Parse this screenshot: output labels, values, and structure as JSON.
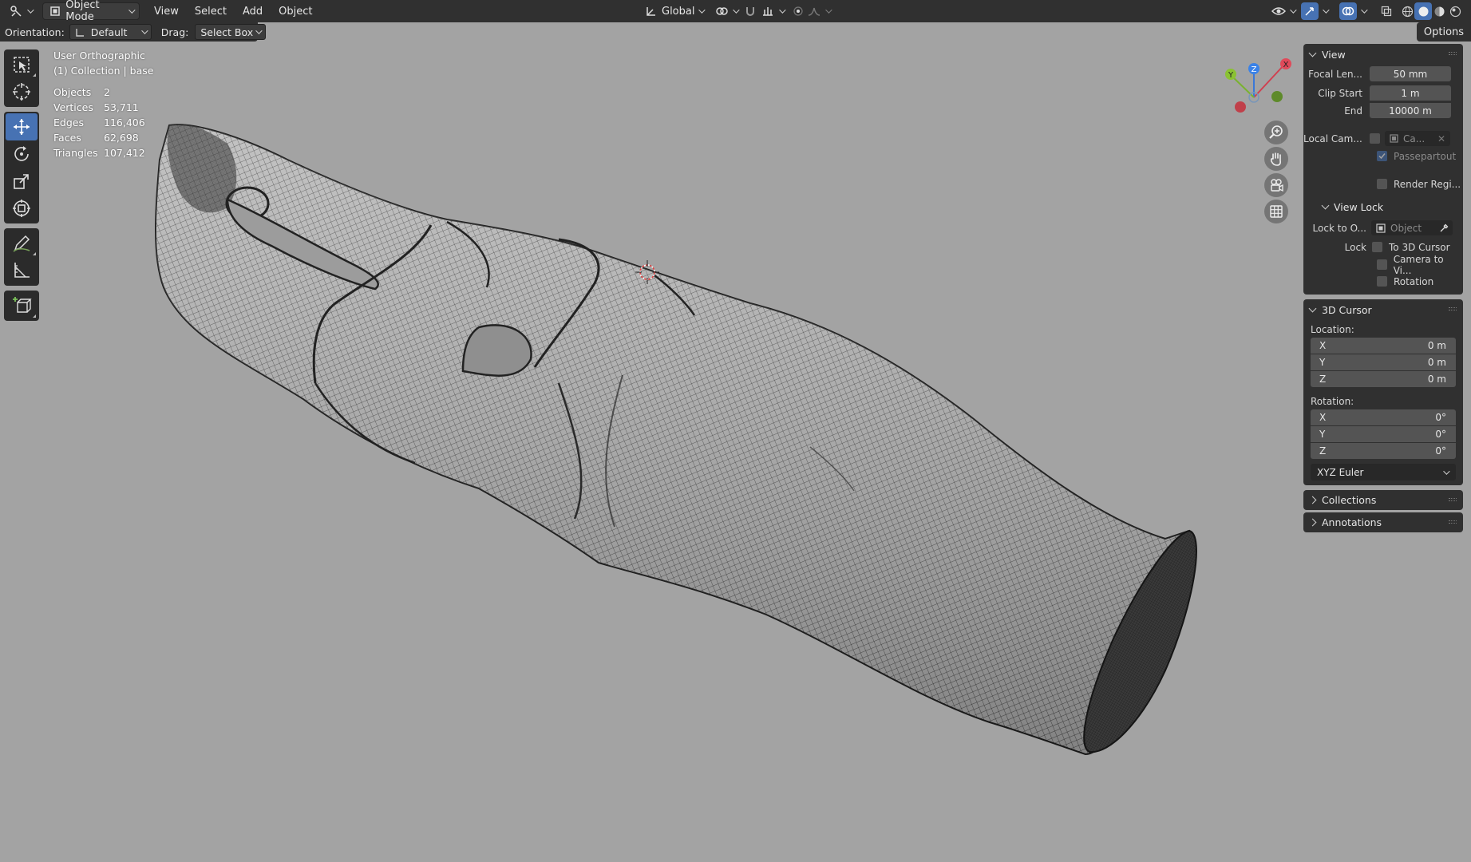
{
  "header": {
    "mode_label": "Object Mode",
    "menus": [
      "View",
      "Select",
      "Add",
      "Object"
    ],
    "transform_orientation": "Global"
  },
  "toolheader": {
    "orientation_label": "Orientation:",
    "orientation_value": "Default",
    "drag_label": "Drag:",
    "drag_value": "Select Box",
    "options_label": "Options"
  },
  "overlay": {
    "view_name": "User Orthographic",
    "collection": "(1) Collection | base",
    "stats": [
      {
        "key": "Objects",
        "value": "2"
      },
      {
        "key": "Vertices",
        "value": "53,711"
      },
      {
        "key": "Edges",
        "value": "116,406"
      },
      {
        "key": "Faces",
        "value": "62,698"
      },
      {
        "key": "Triangles",
        "value": "107,412"
      }
    ]
  },
  "gizmo": {
    "x": "X",
    "y": "Y",
    "z": "Z"
  },
  "panel": {
    "view": {
      "title": "View",
      "focal_length_label": "Focal Len...",
      "focal_length_value": "50 mm",
      "clip_start_label": "Clip Start",
      "clip_start_value": "1 m",
      "clip_end_label": "End",
      "clip_end_value": "10000 m",
      "local_camera_label": "Local Cam...",
      "local_camera_value": "Ca...",
      "passepartout_label": "Passepartout",
      "render_region_label": "Render Regi..."
    },
    "view_lock": {
      "title": "View Lock",
      "lock_to_label": "Lock to O...",
      "lock_to_placeholder": "Object",
      "lock_label": "Lock",
      "to_3d_cursor": "To 3D Cursor",
      "camera_to_view": "Camera to Vi...",
      "rotation": "Rotation"
    },
    "cursor": {
      "title": "3D Cursor",
      "location_label": "Location:",
      "location": [
        {
          "axis": "X",
          "value": "0 m"
        },
        {
          "axis": "Y",
          "value": "0 m"
        },
        {
          "axis": "Z",
          "value": "0 m"
        }
      ],
      "rotation_label": "Rotation:",
      "rotation": [
        {
          "axis": "X",
          "value": "0°"
        },
        {
          "axis": "Y",
          "value": "0°"
        },
        {
          "axis": "Z",
          "value": "0°"
        }
      ],
      "rotation_mode": "XYZ Euler"
    },
    "collections_title": "Collections",
    "annotations_title": "Annotations"
  }
}
